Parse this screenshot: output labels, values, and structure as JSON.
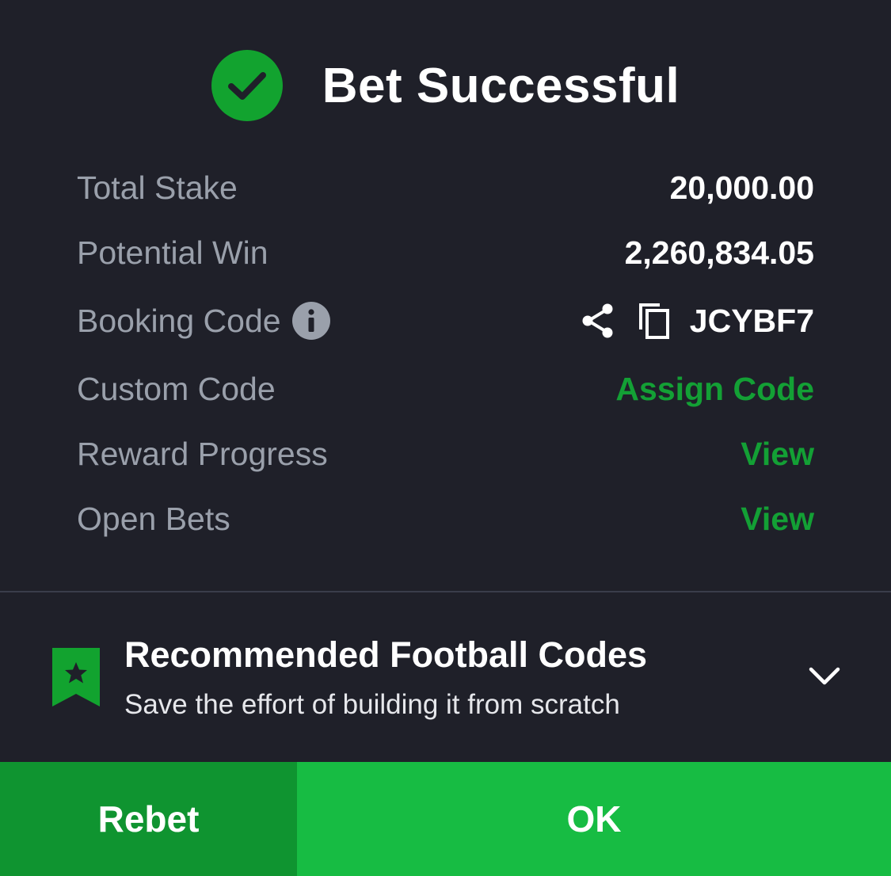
{
  "header": {
    "title": "Bet Successful",
    "icon": "check-circle-icon"
  },
  "details": {
    "total_stake_label": "Total Stake",
    "total_stake_value": "20,000.00",
    "potential_win_label": "Potential Win",
    "potential_win_value": "2,260,834.05",
    "booking_code_label": "Booking Code",
    "booking_code_value": "JCYBF7",
    "custom_code_label": "Custom Code",
    "custom_code_action": "Assign Code",
    "reward_progress_label": "Reward Progress",
    "reward_progress_action": "View",
    "open_bets_label": "Open Bets",
    "open_bets_action": "View"
  },
  "recommendation": {
    "title": "Recommended Football Codes",
    "subtitle": "Save the effort of building it from scratch"
  },
  "actions": {
    "rebet_label": "Rebet",
    "ok_label": "OK"
  },
  "colors": {
    "background": "#1f2029",
    "accent_green": "#13a035",
    "rebet_button": "#0f9430",
    "ok_button": "#17bc43",
    "muted_text": "#9aa0ab"
  }
}
